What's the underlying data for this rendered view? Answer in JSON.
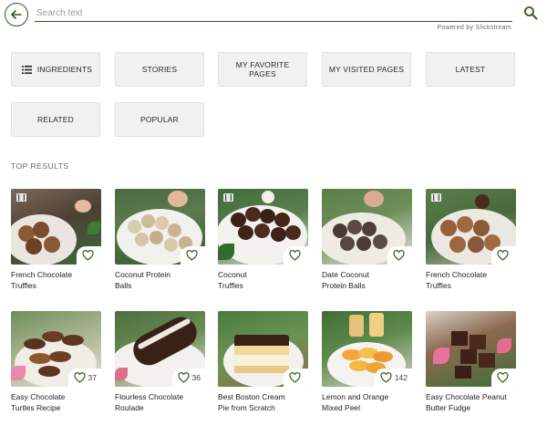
{
  "search": {
    "placeholder": "Search text",
    "powered_by": "Powered by Slickstream"
  },
  "categories": [
    {
      "label": "INGREDIENTS",
      "icon": "list-icon"
    },
    {
      "label": "STORIES"
    },
    {
      "label": "MY FAVORITE PAGES"
    },
    {
      "label": "MY VISITED PAGES"
    },
    {
      "label": "LATEST"
    },
    {
      "label": "RELATED"
    },
    {
      "label": "POPULAR"
    }
  ],
  "section_title": "TOP RESULTS",
  "results": [
    {
      "title": "French Chocolate Truffles",
      "video": true,
      "likes": ""
    },
    {
      "title": "Coconut Protein Balls",
      "video": false,
      "likes": ""
    },
    {
      "title": "Coconut Truffles",
      "video": true,
      "likes": ""
    },
    {
      "title": "Date Coconut Protein Balls",
      "video": false,
      "likes": ""
    },
    {
      "title": "French Chocolate Truffles",
      "video": true,
      "likes": ""
    },
    {
      "title": "Easy Chocolate Turtles Recipe",
      "video": false,
      "likes": "37"
    },
    {
      "title": "Flourless Chocolate Roulade",
      "video": false,
      "likes": "36"
    },
    {
      "title": "Best Boston Cream Pie from Scratch",
      "video": false,
      "likes": ""
    },
    {
      "title": "Lemon and Orange Mixed Peel",
      "video": false,
      "likes": "142"
    },
    {
      "title": "Easy Chocolate Peanut Butter Fudge",
      "video": false,
      "likes": ""
    }
  ],
  "colors": {
    "accent": "#2c5e1a",
    "button_bg": "#f1f1f1"
  }
}
